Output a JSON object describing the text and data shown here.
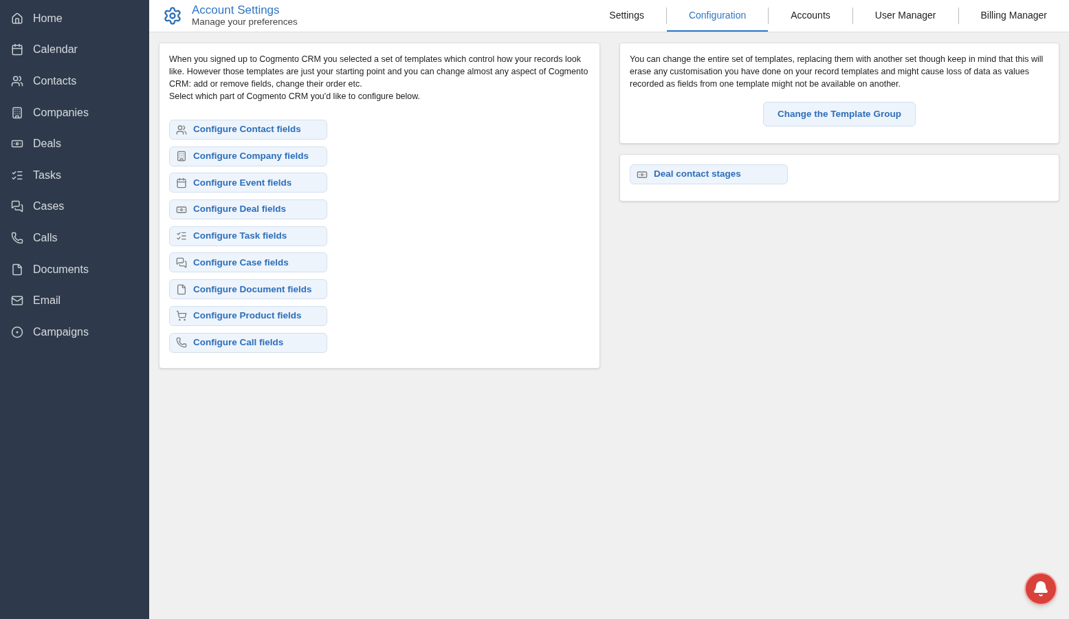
{
  "sidebar": {
    "items": [
      {
        "label": "Home",
        "selected": false
      },
      {
        "label": "Calendar",
        "selected": false
      },
      {
        "label": "Contacts",
        "selected": false
      },
      {
        "label": "Companies",
        "selected": false
      },
      {
        "label": "Deals",
        "selected": false
      },
      {
        "label": "Tasks",
        "selected": false
      },
      {
        "label": "Cases",
        "selected": false
      },
      {
        "label": "Calls",
        "selected": false
      },
      {
        "label": "Documents",
        "selected": false
      },
      {
        "label": "Email",
        "selected": false
      },
      {
        "label": "Campaigns",
        "selected": false
      }
    ]
  },
  "header": {
    "title": "Account Settings",
    "subtitle": "Manage your preferences"
  },
  "tabs": [
    {
      "label": "Settings",
      "selected": false
    },
    {
      "label": "Configuration",
      "selected": true
    },
    {
      "label": "Accounts",
      "selected": false
    },
    {
      "label": "User Manager",
      "selected": false
    },
    {
      "label": "Billing Manager",
      "selected": false
    }
  ],
  "left_panel": {
    "paragraphs": [
      "When you signed up to Cogmento CRM you selected a set of templates which control how your records look like. However those templates are just your starting point and you can change almost any aspect of Cogmento CRM: add or remove fields, change their order etc.",
      "Select which part of Cogmento CRM you'd like to configure below."
    ],
    "buttons": [
      {
        "label": "Configure Contact fields",
        "kind": "contacts"
      },
      {
        "label": "Configure Company fields",
        "kind": "company"
      },
      {
        "label": "Configure Event fields",
        "kind": "calendar"
      },
      {
        "label": "Configure Deal fields",
        "kind": "money"
      },
      {
        "label": "Configure Task fields",
        "kind": "tasks"
      },
      {
        "label": "Configure Case fields",
        "kind": "chat"
      },
      {
        "label": "Configure Document fields",
        "kind": "file"
      },
      {
        "label": "Configure Product fields",
        "kind": "cart"
      },
      {
        "label": "Configure Call fields",
        "kind": "phone"
      }
    ]
  },
  "template_panel": {
    "text": "You can change the entire set of templates, replacing them with another set though keep in mind that this will erase any customisation you have done on your record templates and might cause loss of data as values recorded as fields from one template might not be available on another.",
    "button": "Change the Template Group"
  },
  "stages_panel": {
    "buttons": [
      {
        "label": "Deal contact stages",
        "kind": "money"
      }
    ]
  }
}
